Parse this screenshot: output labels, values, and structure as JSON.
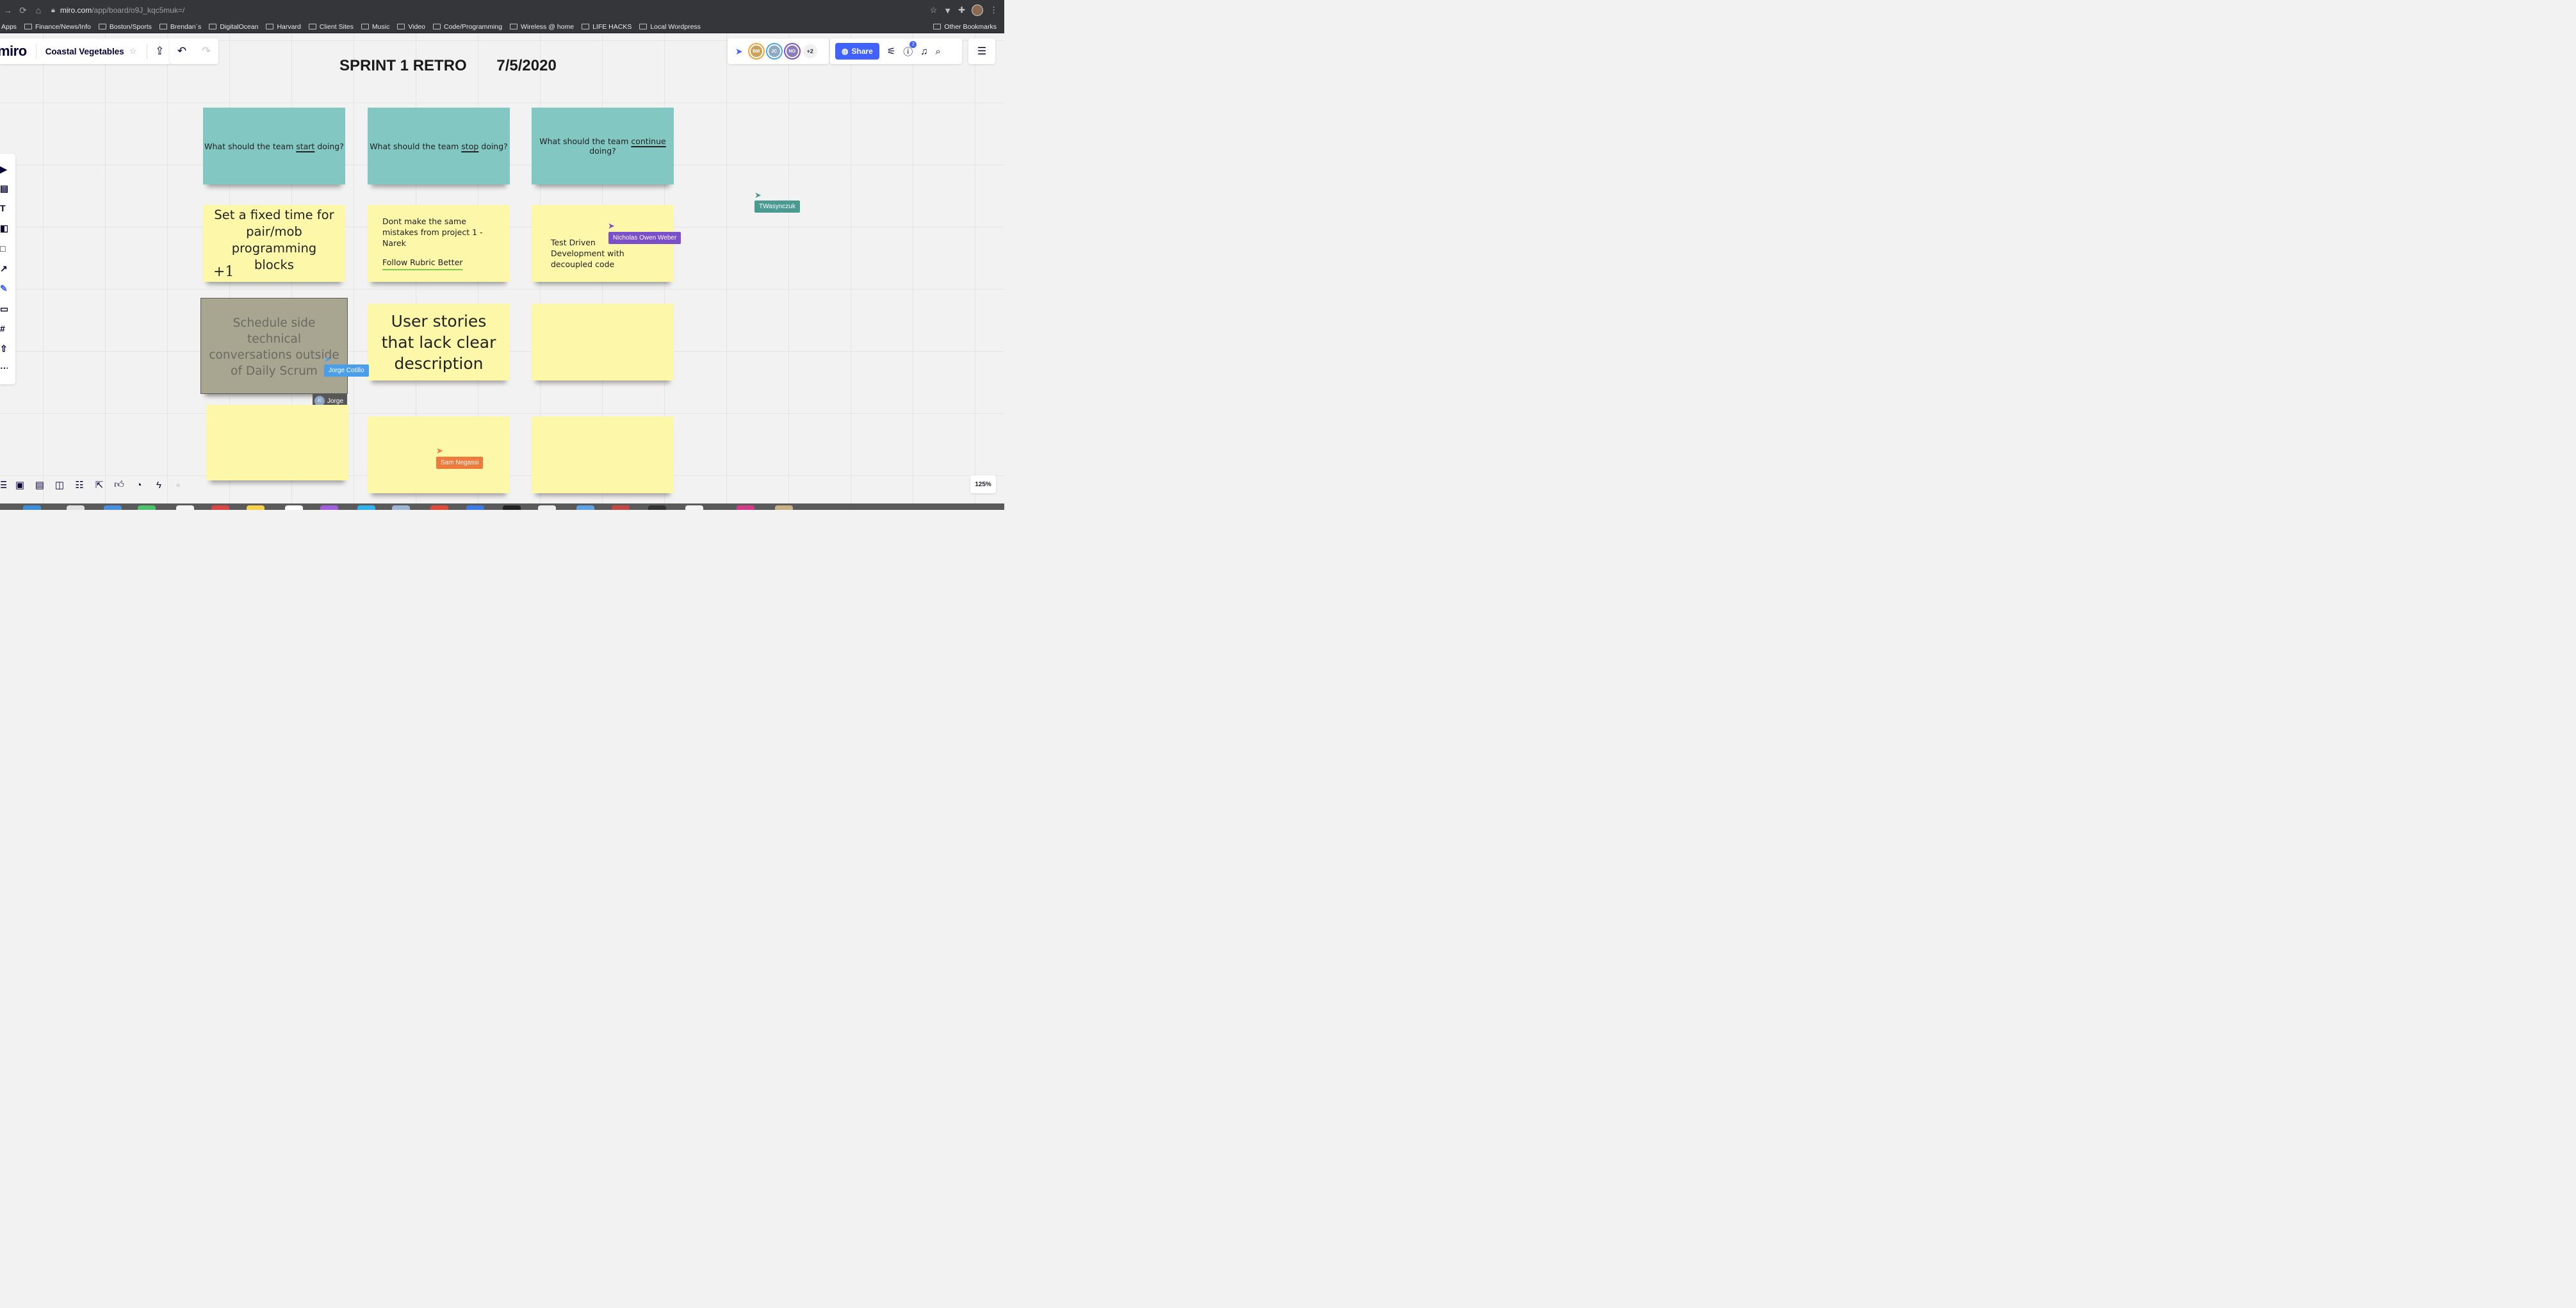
{
  "browser": {
    "url_host": "miro.com",
    "url_path": "/app/board/o9J_kqc5muk=/",
    "bookmarks": [
      "Apps",
      "Finance/News/Info",
      "Boston/Sports",
      "Brendan`s",
      "DigitalOcean",
      "Harvard",
      "Client Sites",
      "Music",
      "Video",
      "Code/Programming",
      "Wireless @ home",
      "LIFE HACKS",
      "Local Wordpress"
    ],
    "other_bookmarks": "Other Bookmarks"
  },
  "app": {
    "logo": "miro",
    "board_name": "Coastal Vegetables"
  },
  "collaborators": {
    "avatars": [
      {
        "initials": "BM",
        "color": "#c9a25c",
        "ring": "#f2a33a"
      },
      {
        "initials": "JC",
        "color": "#8fa9c4",
        "ring": "#4aa3df"
      },
      {
        "initials": "NO",
        "color": "#8a7cb8",
        "ring": "#7b4fc9"
      }
    ],
    "more": "+2"
  },
  "toolbar": {
    "share_label": "Share",
    "notification_count": "2"
  },
  "board": {
    "title": "SPRINT 1 RETRO       7/5/2020",
    "headers": {
      "start_pre": "What should the team ",
      "start_word": "start",
      "start_post": " doing?",
      "stop_pre": "What should the team ",
      "stop_word": "stop",
      "stop_post": " doing?",
      "continue_pre": "What should the team ",
      "continue_word": "continue",
      "continue_post": " doing?"
    },
    "notes": {
      "fixed_time": "Set a fixed time for pair/mob programming blocks",
      "plus_one": "+1",
      "mistakes": "Dont make the same mistakes from project 1 -Narek",
      "rubric": "Follow Rubric Better",
      "tdd": "Test Driven Development with decoupled code",
      "schedule": "Schedule side technical conversations outside of Daily Scrum",
      "user_stories": "User stories that lack clear description"
    },
    "selection_owner": {
      "initials": "JC",
      "name": "Jorge"
    }
  },
  "cursors": [
    {
      "name": "TWasynczuk",
      "color": "#4a9a92"
    },
    {
      "name": "Nicholas Owen Weber",
      "color": "#7b4fc9"
    },
    {
      "name": "Jorge Cotillo",
      "color": "#4a9eea"
    },
    {
      "name": "Sam Negassi",
      "color": "#ef7a3c"
    }
  ],
  "zoom": "125%",
  "colors": {
    "teal_sticky": "#82c7c2",
    "yellow_sticky": "#fdf7a9",
    "accent": "#4262ff"
  }
}
